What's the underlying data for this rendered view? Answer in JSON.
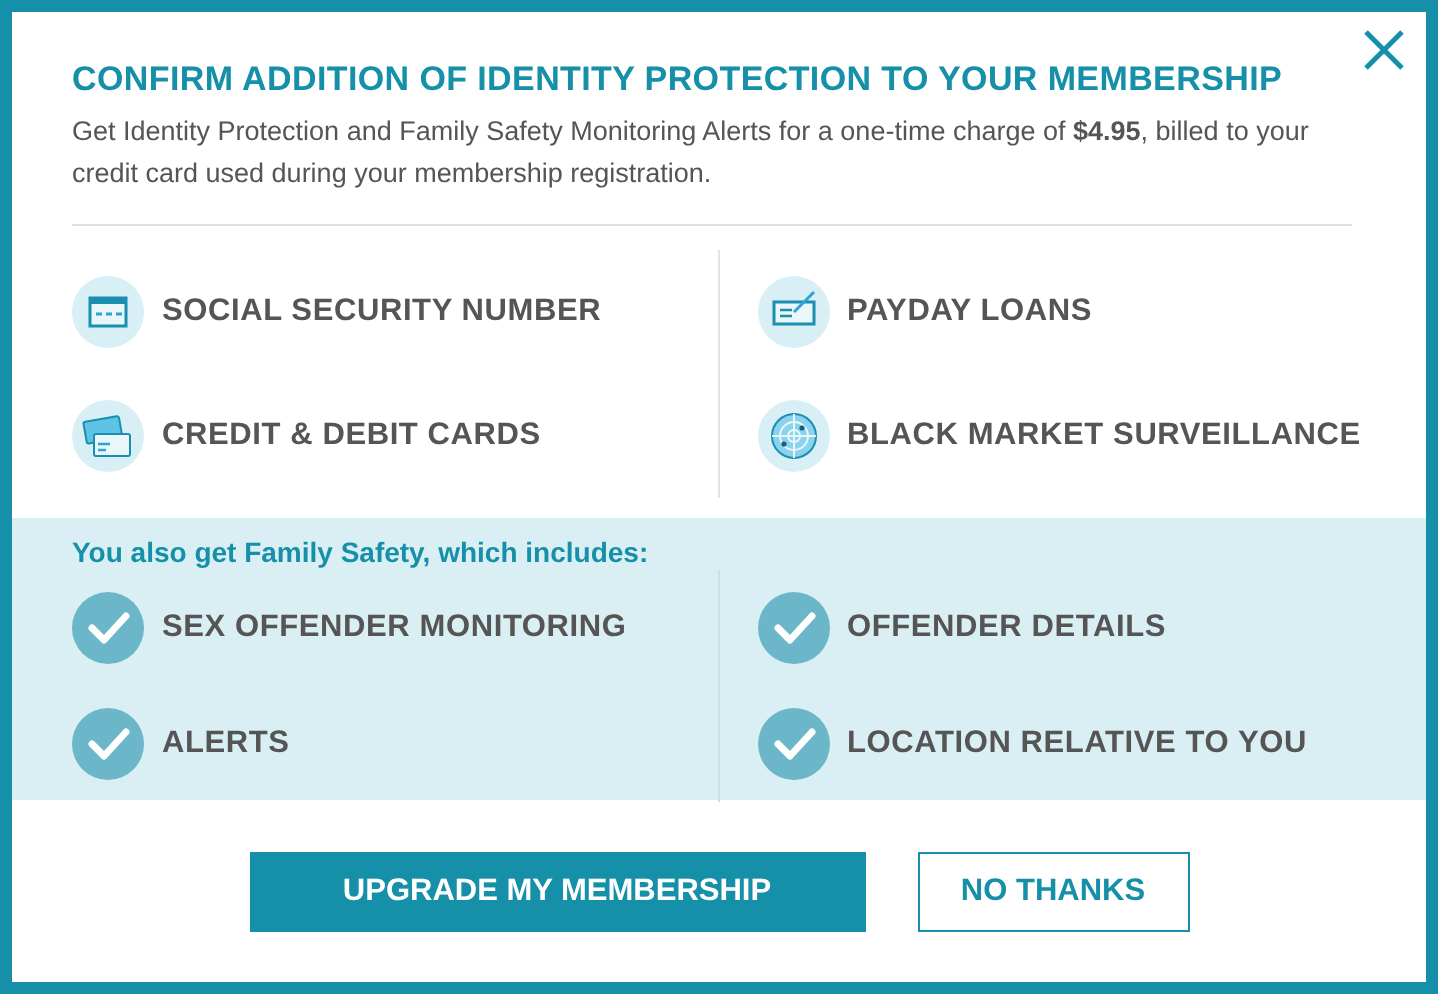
{
  "dialog": {
    "title": "CONFIRM ADDITION OF IDENTITY PROTECTION TO YOUR MEMBERSHIP",
    "description": "Get Identity Protection and Family Safety Monitoring Alerts for a one-time charge of **$4.95**, billed to your credit card used during your membership registration."
  },
  "features": [
    {
      "label": "SOCIAL SECURITY NUMBER",
      "kind": "id-card"
    },
    {
      "label": "PAYDAY LOANS",
      "kind": "check"
    },
    {
      "label": "CREDIT & DEBIT CARDS",
      "kind": "cards"
    },
    {
      "label": "BLACK MARKET SURVEILLANCE",
      "kind": "radar"
    }
  ],
  "family_safety": {
    "heading": "You also get Family Safety, which includes:",
    "items": [
      {
        "label": "SEX OFFENDER MONITORING"
      },
      {
        "label": "OFFENDER DETAILS"
      },
      {
        "label": "ALERTS"
      },
      {
        "label": "LOCATION RELATIVE TO YOU"
      }
    ]
  },
  "buttons": [
    {
      "label": "UPGRADE MY MEMBERSHIP",
      "kind": "primary"
    },
    {
      "label": "NO THANKS",
      "kind": "secondary"
    }
  ]
}
